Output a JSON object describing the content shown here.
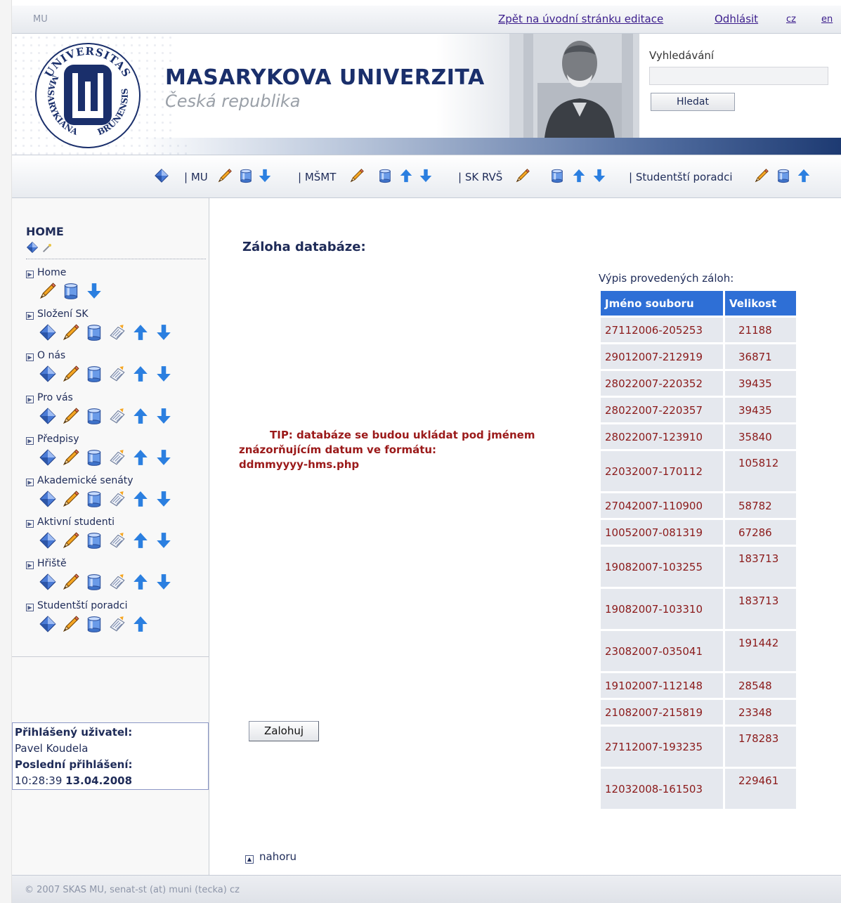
{
  "topbar": {
    "site": "MU",
    "back_link": "Zpět na úvodní stránku editace",
    "logout": "Odhlásit",
    "lang_cz": "cz",
    "lang_en": "en"
  },
  "header": {
    "logo_text_top": "UNIVERSITAS",
    "logo_text_left": "MASARYKIANA",
    "logo_text_right": "BRUNENSIS",
    "title": "MASARYKOVA UNIVERZITA",
    "subtitle": "Česká republika",
    "search_label": "Vyhledávání",
    "search_value": "",
    "search_button": "Hledat"
  },
  "toolbar": {
    "sections": [
      "| MU",
      "| MŠMT",
      "| SK RVŠ",
      "| Studentští poradci"
    ]
  },
  "sidebar": {
    "home_title": "HOME",
    "items": [
      {
        "label": "Home",
        "icons": [
          "pencil-icon",
          "database-icon",
          "arrow-down-icon"
        ]
      },
      {
        "label": "Složení SK",
        "icons": [
          "diamond-icon",
          "pencil-icon",
          "database-icon",
          "document-icon",
          "arrow-up-icon",
          "arrow-down-icon"
        ]
      },
      {
        "label": "O nás",
        "icons": [
          "diamond-icon",
          "pencil-icon",
          "database-icon",
          "document-icon",
          "arrow-up-icon",
          "arrow-down-icon"
        ]
      },
      {
        "label": "Pro vás",
        "icons": [
          "diamond-icon",
          "pencil-icon",
          "database-icon",
          "document-icon",
          "arrow-up-icon",
          "arrow-down-icon"
        ]
      },
      {
        "label": "Předpisy",
        "icons": [
          "diamond-icon",
          "pencil-icon",
          "database-icon",
          "document-icon",
          "arrow-up-icon",
          "arrow-down-icon"
        ]
      },
      {
        "label": "Akademické senáty",
        "icons": [
          "diamond-icon",
          "pencil-icon",
          "database-icon",
          "document-icon",
          "arrow-up-icon",
          "arrow-down-icon"
        ]
      },
      {
        "label": "Aktivní studenti",
        "icons": [
          "diamond-icon",
          "pencil-icon",
          "database-icon",
          "document-icon",
          "arrow-up-icon",
          "arrow-down-icon"
        ]
      },
      {
        "label": "Hřiště",
        "icons": [
          "diamond-icon",
          "pencil-icon",
          "database-icon",
          "document-icon",
          "arrow-up-icon",
          "arrow-down-icon"
        ]
      },
      {
        "label": "Studentští poradci",
        "icons": [
          "diamond-icon",
          "pencil-icon",
          "database-icon",
          "document-icon",
          "arrow-up-icon"
        ]
      }
    ],
    "user": {
      "logged_label": "Přihlášený uživatel:",
      "name": "Pavel Koudela",
      "last_login_label": "Poslední přihlášení:",
      "last_login_time": "10:28:39",
      "last_login_date": "13.04.2008"
    }
  },
  "main": {
    "title": "Záloha databáze:",
    "tip_line1": "TIP: databáze se budou ukládat pod jménem",
    "tip_line2": "znázorňujícím datum ve formátu:",
    "tip_line3": "ddmmyyyy-hms.php",
    "save_button": "Zalohuj",
    "backups_caption": "Výpis provedených záloh:",
    "columns": [
      "Jméno souboru",
      "Velikost"
    ],
    "backups": [
      {
        "name": "27112006-205253",
        "size": "21188"
      },
      {
        "name": "29012007-212919",
        "size": "36871"
      },
      {
        "name": "28022007-220352",
        "size": "39435"
      },
      {
        "name": "28022007-220357",
        "size": "39435"
      },
      {
        "name": "28022007-123910",
        "size": "35840"
      },
      {
        "name": "22032007-170112",
        "size": "105812"
      },
      {
        "name": "27042007-110900",
        "size": "58782"
      },
      {
        "name": "10052007-081319",
        "size": "67286"
      },
      {
        "name": "19082007-103255",
        "size": "183713"
      },
      {
        "name": "19082007-103310",
        "size": "183713"
      },
      {
        "name": "23082007-035041",
        "size": "191442"
      },
      {
        "name": "19102007-112148",
        "size": "28548"
      },
      {
        "name": "21082007-215819",
        "size": "23348"
      },
      {
        "name": "27112007-193235",
        "size": "178283"
      },
      {
        "name": "12032008-161503",
        "size": "229461"
      }
    ],
    "up_link": "nahoru"
  },
  "footer": {
    "text": "© 2007 SKAS MU, senat-st (at) muni (tecka) cz"
  },
  "colors": {
    "navy": "#1e2b58",
    "table_header": "#2e6fd6",
    "table_cell": "#e5e8ee",
    "tip_red": "#9b1a1a",
    "icon_blue": "#2b7fe0"
  }
}
